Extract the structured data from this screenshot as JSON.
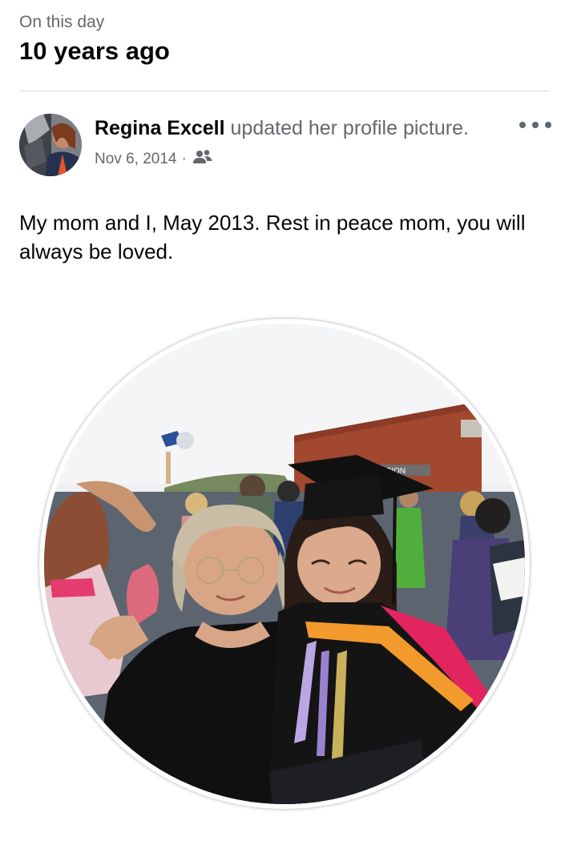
{
  "memory": {
    "kicker": "On this day",
    "title": "10 years ago"
  },
  "post": {
    "author": "Regina Excell",
    "action": " updated her profile picture.",
    "date": "Nov 6, 2014",
    "separator": "·",
    "audience_icon": "friends-icon",
    "more_icon": "more-options-icon",
    "caption": "My mom and I, May 2013. Rest in peace mom, you will always be loved.",
    "photo_sign_text": "PASION"
  },
  "colors": {
    "secondary_text": "#65676b",
    "primary_text": "#050505",
    "divider": "#d6d8dc"
  }
}
